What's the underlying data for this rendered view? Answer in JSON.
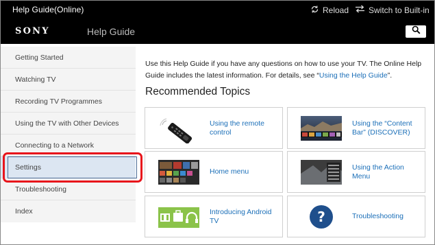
{
  "window": {
    "title": "Help Guide(Online)",
    "reload_label": "Reload",
    "switch_label": "Switch to Built-in"
  },
  "header": {
    "logo": "SONY",
    "subtitle": "Help Guide"
  },
  "sidebar": {
    "items": [
      {
        "label": "Getting Started"
      },
      {
        "label": "Watching TV"
      },
      {
        "label": "Recording TV Programmes"
      },
      {
        "label": "Using the TV with Other Devices"
      },
      {
        "label": "Connecting to a Network"
      },
      {
        "label": "Settings",
        "selected": true
      },
      {
        "label": "Troubleshooting"
      },
      {
        "label": "Index"
      }
    ]
  },
  "main": {
    "intro_text": "Use this Help Guide if you have any questions on how to use your TV. The Online Help Guide includes the latest information. For details, see “",
    "intro_link": "Using the Help Guide",
    "intro_end": "”.",
    "section_title": "Recommended Topics",
    "topics": [
      {
        "label": "Using the remote control",
        "icon": "remote-control"
      },
      {
        "label": "Using the “Content Bar” (DISCOVER)",
        "icon": "content-bar-screenshot"
      },
      {
        "label": "Home menu",
        "icon": "home-menu-screenshot"
      },
      {
        "label": "Using the Action Menu",
        "icon": "action-menu-screenshot"
      },
      {
        "label": "Introducing Android TV",
        "icon": "android-tv-apps"
      },
      {
        "label": "Troubleshooting",
        "icon": "question-mark"
      }
    ]
  },
  "colors": {
    "accent_link": "#1b6fb8",
    "highlight": "#e8141b",
    "selected_bg": "#dce6f2"
  }
}
